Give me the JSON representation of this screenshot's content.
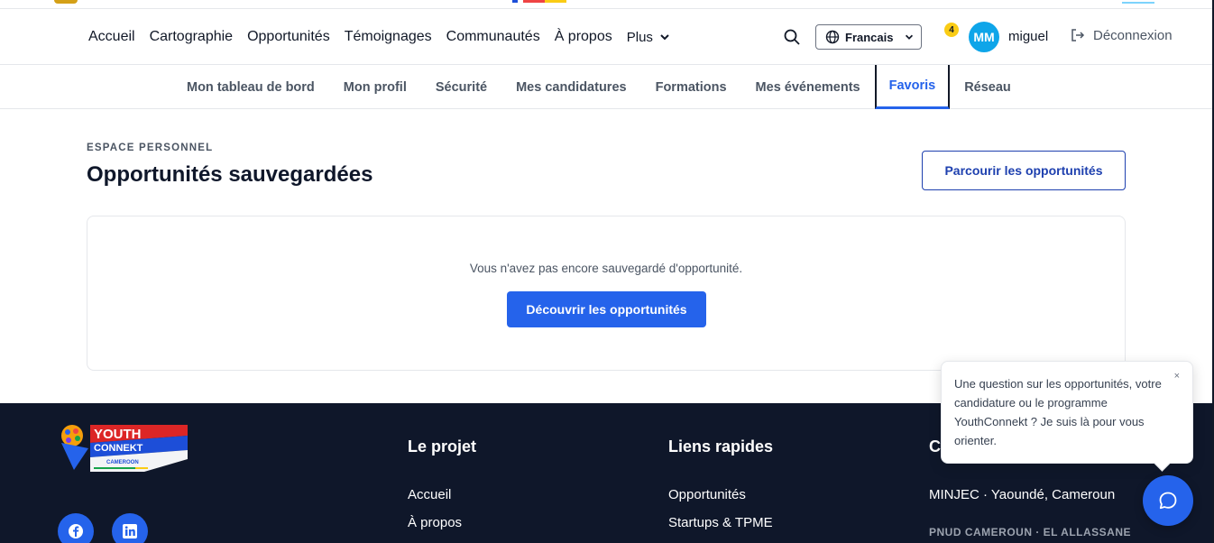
{
  "main_nav": {
    "links": [
      "Accueil",
      "Cartographie",
      "Opportunités",
      "Témoignages",
      "Communautés",
      "À propos"
    ],
    "more_label": "Plus",
    "language": "Francais",
    "notification_count": "4",
    "avatar_initials": "MM",
    "username": "miguel",
    "logout_label": "Déconnexion"
  },
  "sub_nav": {
    "tabs": [
      "Mon tableau de bord",
      "Mon profil",
      "Sécurité",
      "Mes candidatures",
      "Formations",
      "Mes événements",
      "Favoris",
      "Réseau"
    ],
    "active_tab": "Favoris"
  },
  "page": {
    "eyebrow": "ESPACE PERSONNEL",
    "title": "Opportunités sauvegardées",
    "browse_button": "Parcourir les opportunités",
    "empty_message": "Vous n'avez pas encore sauvegardé d'opportunité.",
    "discover_button": "Découvrir les opportunités"
  },
  "footer": {
    "logo": {
      "line1": "YOUTH",
      "line2": "CONNEKT",
      "line3": "CAMEROON"
    },
    "social_icons": [
      "facebook-icon",
      "linkedin-icon"
    ],
    "col_projet": {
      "title": "Le projet",
      "links": [
        "Accueil",
        "À propos"
      ]
    },
    "col_liens": {
      "title": "Liens rapides",
      "links": [
        "Opportunités",
        "Startups & TPME"
      ]
    },
    "col_contact": {
      "title": "C",
      "address": "MINJEC · Yaoundé, Cameroun",
      "partner": "PNUD CAMEROUN · EL ALLASSANE"
    }
  },
  "chat": {
    "message": "Une question sur les opportunités, votre candidature ou le programme YouthConnekt ? Je suis là pour vous orienter.",
    "close_label": "×"
  },
  "colors": {
    "primary": "#2563eb",
    "footer_bg": "#0f172a",
    "badge": "#facc15",
    "avatar": "#0ea5e9"
  }
}
